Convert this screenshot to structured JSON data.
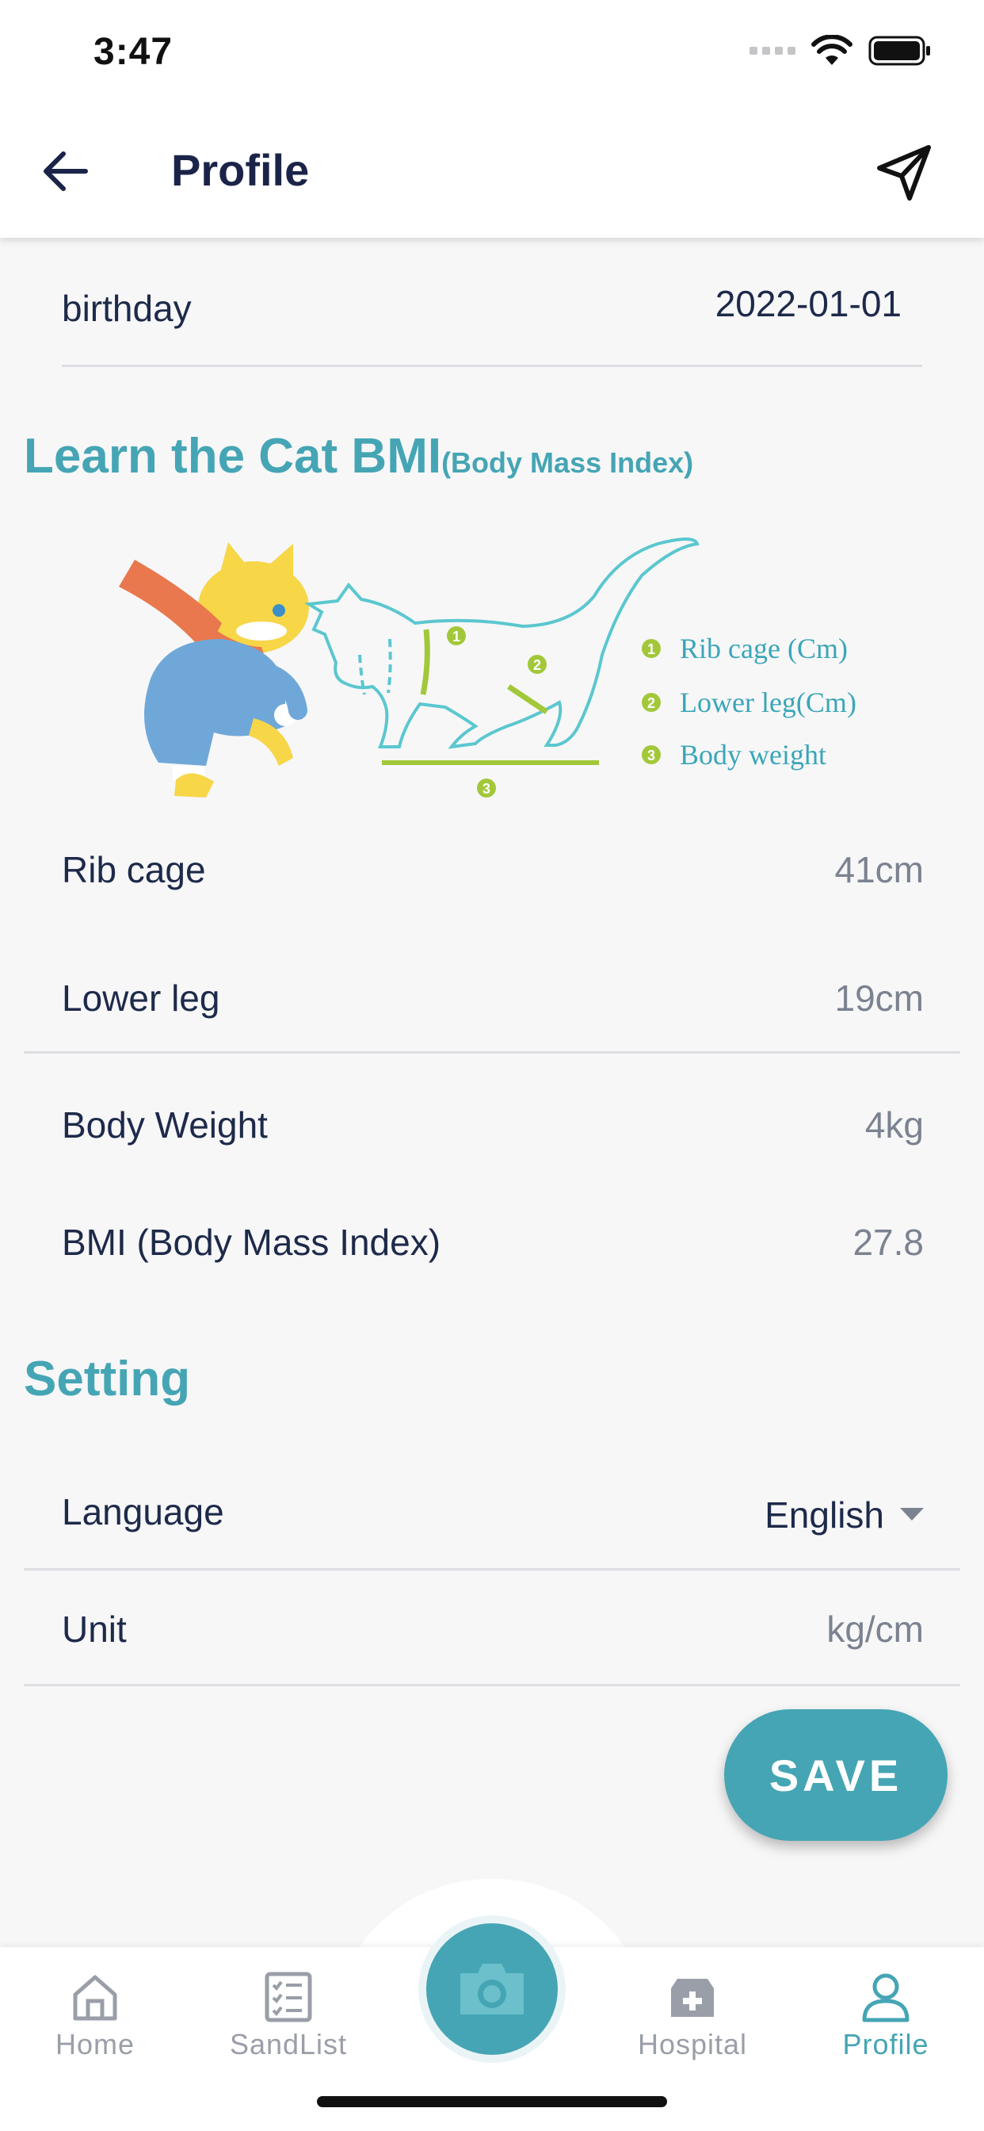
{
  "status": {
    "time": "3:47"
  },
  "header": {
    "title": "Profile"
  },
  "birthday": {
    "label": "birthday",
    "value": "2022-01-01"
  },
  "bmi_section": {
    "title": "Learn the Cat BMI",
    "subtitle": "(Body Mass Index)",
    "legend": [
      "Rib cage (Cm)",
      "Lower leg(Cm)",
      "Body weight"
    ]
  },
  "measurements": [
    {
      "label": "Rib cage",
      "value": "41cm"
    },
    {
      "label": "Lower leg",
      "value": "19cm"
    },
    {
      "label": "Body Weight",
      "value": "4kg"
    },
    {
      "label": "BMI (Body Mass Index)",
      "value": "27.8"
    }
  ],
  "setting": {
    "title": "Setting",
    "language": {
      "label": "Language",
      "value": "English"
    },
    "unit": {
      "label": "Unit",
      "value": "kg/cm"
    }
  },
  "save_label": "SAVE",
  "tabs": [
    {
      "label": "Home",
      "icon": "home-icon"
    },
    {
      "label": "SandList",
      "icon": "checklist-icon"
    },
    {
      "label": "Hospital",
      "icon": "hospital-icon"
    },
    {
      "label": "Profile",
      "icon": "user-icon"
    }
  ],
  "colors": {
    "accent": "#45a5b4",
    "text": "#1e2a4a",
    "muted": "#7b8290"
  }
}
